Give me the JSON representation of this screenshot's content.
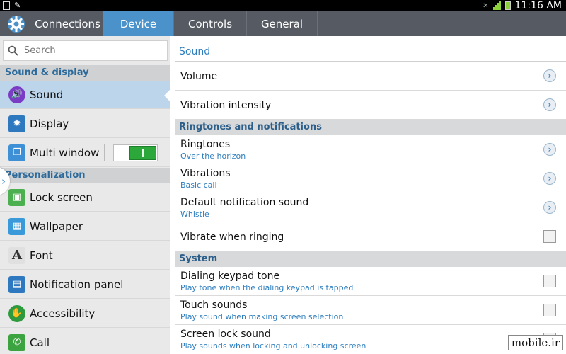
{
  "status_bar": {
    "time": "11:16 AM",
    "left_icons": [
      "doc-icon",
      "pencil-icon"
    ],
    "right_icons": [
      "mute-icon",
      "wifi-icon",
      "signal-icon",
      "battery-icon"
    ]
  },
  "tabs": [
    {
      "label": "Connections",
      "active": false
    },
    {
      "label": "Device",
      "active": true
    },
    {
      "label": "Controls",
      "active": false
    },
    {
      "label": "General",
      "active": false
    }
  ],
  "search": {
    "placeholder": "Search"
  },
  "sidebar": {
    "sections": [
      {
        "header": "Sound & display",
        "items": [
          {
            "label": "Sound",
            "icon": "speaker-icon",
            "active": true
          },
          {
            "label": "Display",
            "icon": "sun-icon",
            "active": false
          },
          {
            "label": "Multi window",
            "icon": "multi-window-icon",
            "active": false,
            "toggle_on": true
          }
        ]
      },
      {
        "header": "Personalization",
        "items": [
          {
            "label": "Lock screen",
            "icon": "lock-screen-icon"
          },
          {
            "label": "Wallpaper",
            "icon": "wallpaper-icon"
          },
          {
            "label": "Font",
            "icon": "font-icon"
          },
          {
            "label": "Notification panel",
            "icon": "notification-panel-icon"
          },
          {
            "label": "Accessibility",
            "icon": "hand-icon"
          },
          {
            "label": "Call",
            "icon": "phone-icon"
          }
        ]
      }
    ]
  },
  "main": {
    "title": "Sound",
    "rows_top": [
      {
        "label": "Volume",
        "control": "chevron"
      },
      {
        "label": "Vibration intensity",
        "control": "chevron"
      }
    ],
    "section_ringtones": {
      "header": "Ringtones and notifications",
      "rows": [
        {
          "label": "Ringtones",
          "sub": "Over the horizon",
          "control": "chevron"
        },
        {
          "label": "Vibrations",
          "sub": "Basic call",
          "control": "chevron"
        },
        {
          "label": "Default notification sound",
          "sub": "Whistle",
          "control": "chevron"
        },
        {
          "label": "Vibrate when ringing",
          "control": "checkbox",
          "checked": false
        }
      ]
    },
    "section_system": {
      "header": "System",
      "rows": [
        {
          "label": "Dialing keypad tone",
          "sub": "Play tone when the dialing keypad is tapped",
          "control": "checkbox",
          "checked": false
        },
        {
          "label": "Touch sounds",
          "sub": "Play sound when making screen selection",
          "control": "checkbox",
          "checked": false
        },
        {
          "label": "Screen lock sound",
          "sub": "Play sounds when locking and unlocking screen",
          "control": "checkbox",
          "checked": false
        }
      ]
    }
  },
  "watermark": "mobile.ir",
  "colors": {
    "tab_bar": "#565b63",
    "tab_active": "#4a92c9",
    "accent_text": "#2f7fbf",
    "toggle_on": "#2ca83a"
  }
}
